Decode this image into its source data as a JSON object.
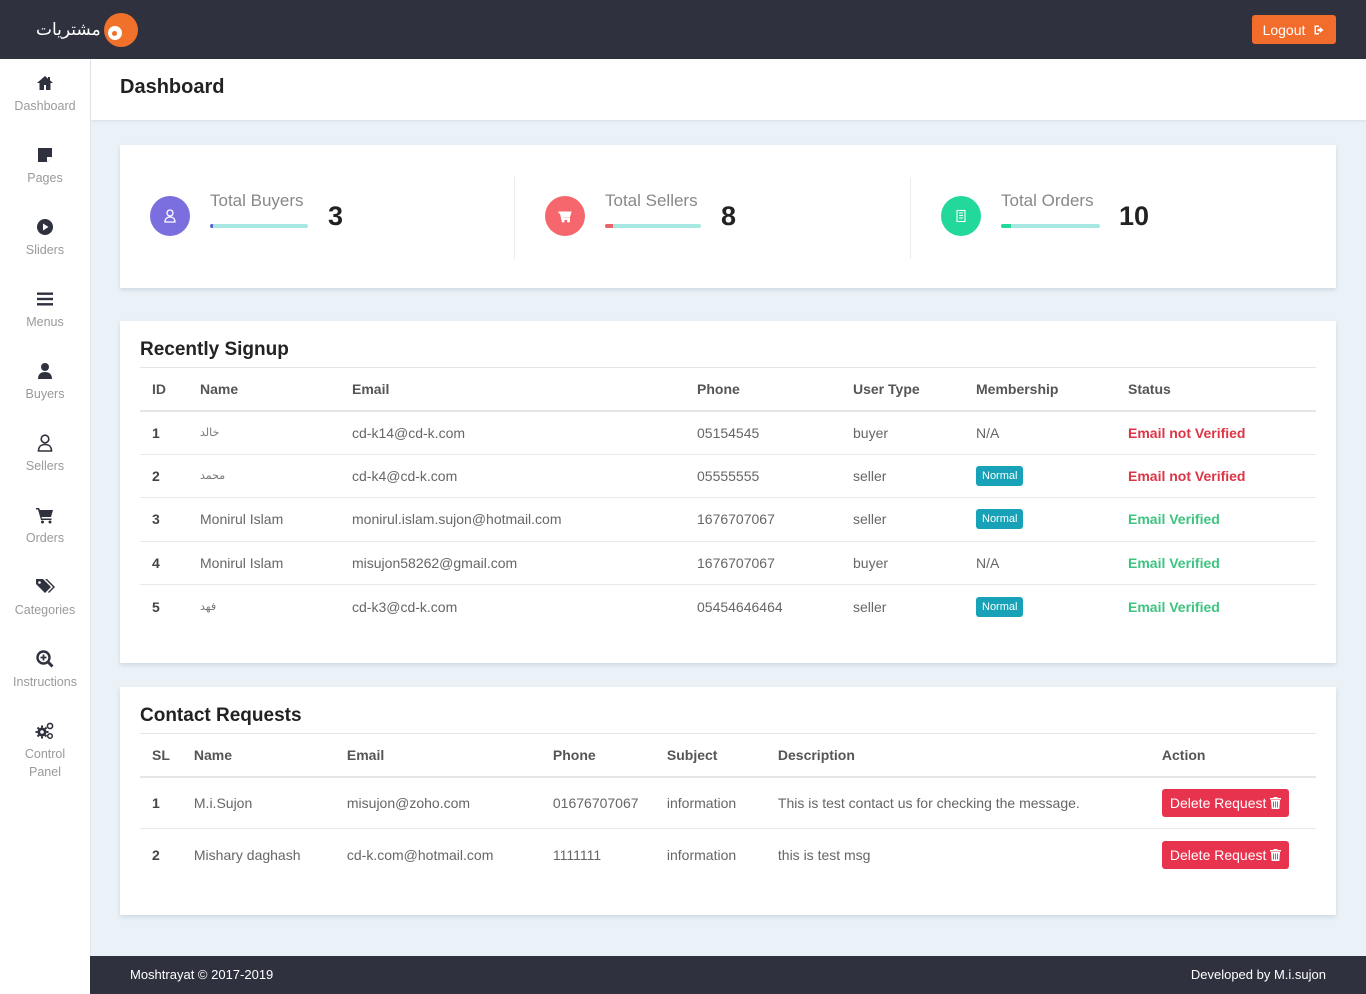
{
  "header": {
    "logo_text": "مشتريات",
    "logout_label": "Logout"
  },
  "sidebar": {
    "items": [
      {
        "label": "Dashboard",
        "icon": "home-icon"
      },
      {
        "label": "Pages",
        "icon": "sticky-note-icon"
      },
      {
        "label": "Sliders",
        "icon": "play-circle-icon"
      },
      {
        "label": "Menus",
        "icon": "bars-icon"
      },
      {
        "label": "Buyers",
        "icon": "user-icon"
      },
      {
        "label": "Sellers",
        "icon": "user-outline-icon"
      },
      {
        "label": "Orders",
        "icon": "cart-icon"
      },
      {
        "label": "Categories",
        "icon": "tags-icon"
      },
      {
        "label": "Instructions",
        "icon": "search-plus-icon"
      },
      {
        "label": "Control Panel",
        "icon": "cogs-icon"
      }
    ]
  },
  "page": {
    "title": "Dashboard"
  },
  "stats": [
    {
      "label": "Total Buyers",
      "value": "3",
      "icon": "user-outline-icon",
      "color": "#7b6fe0",
      "progress_percent": 3
    },
    {
      "label": "Total Sellers",
      "value": "8",
      "icon": "cart-icon",
      "color": "#f5676d",
      "progress_percent": 8
    },
    {
      "label": "Total Orders",
      "value": "10",
      "icon": "receipt-icon",
      "color": "#22d89a",
      "progress_percent": 10
    }
  ],
  "recent_signup": {
    "title": "Recently Signup",
    "columns": [
      "ID",
      "Name",
      "Email",
      "Phone",
      "User Type",
      "Membership",
      "Status"
    ],
    "rows": [
      {
        "id": "1",
        "name": "خالد",
        "email": "cd-k14@cd-k.com",
        "phone": "05154545",
        "user_type": "buyer",
        "membership": "N/A",
        "status": "Email not Verified",
        "verified": false
      },
      {
        "id": "2",
        "name": "محمد",
        "email": "cd-k4@cd-k.com",
        "phone": "05555555",
        "user_type": "seller",
        "membership": "Normal",
        "status": "Email not Verified",
        "verified": false
      },
      {
        "id": "3",
        "name": "Monirul Islam",
        "email": "monirul.islam.sujon@hotmail.com",
        "phone": "1676707067",
        "user_type": "seller",
        "membership": "Normal",
        "status": "Email Verified",
        "verified": true
      },
      {
        "id": "4",
        "name": "Monirul Islam",
        "email": "misujon58262@gmail.com",
        "phone": "1676707067",
        "user_type": "buyer",
        "membership": "N/A",
        "status": "Email Verified",
        "verified": true
      },
      {
        "id": "5",
        "name": "فهد",
        "email": "cd-k3@cd-k.com",
        "phone": "05454646464",
        "user_type": "seller",
        "membership": "Normal",
        "status": "Email Verified",
        "verified": true
      }
    ]
  },
  "contact_requests": {
    "title": "Contact Requests",
    "columns": [
      "SL",
      "Name",
      "Email",
      "Phone",
      "Subject",
      "Description",
      "Action"
    ],
    "action_label": "Delete Request",
    "rows": [
      {
        "sl": "1",
        "name": "M.i.Sujon",
        "email": "misujon@zoho.com",
        "phone": "01676707067",
        "subject": "information",
        "description": "This is test contact us for checking the message."
      },
      {
        "sl": "2",
        "name": "Mishary daghash",
        "email": "cd-k.com@hotmail.com",
        "phone": "1111111",
        "subject": "information",
        "description": "this is test msg"
      }
    ]
  },
  "footer": {
    "left": "Moshtrayat © 2017-2019",
    "right": "Developed by M.i.sujon"
  },
  "colors": {
    "topbar": "#2f323e",
    "accent_orange": "#f26c2c",
    "danger": "#e8334f",
    "success": "#3cc480",
    "badge": "#17a2b8"
  }
}
